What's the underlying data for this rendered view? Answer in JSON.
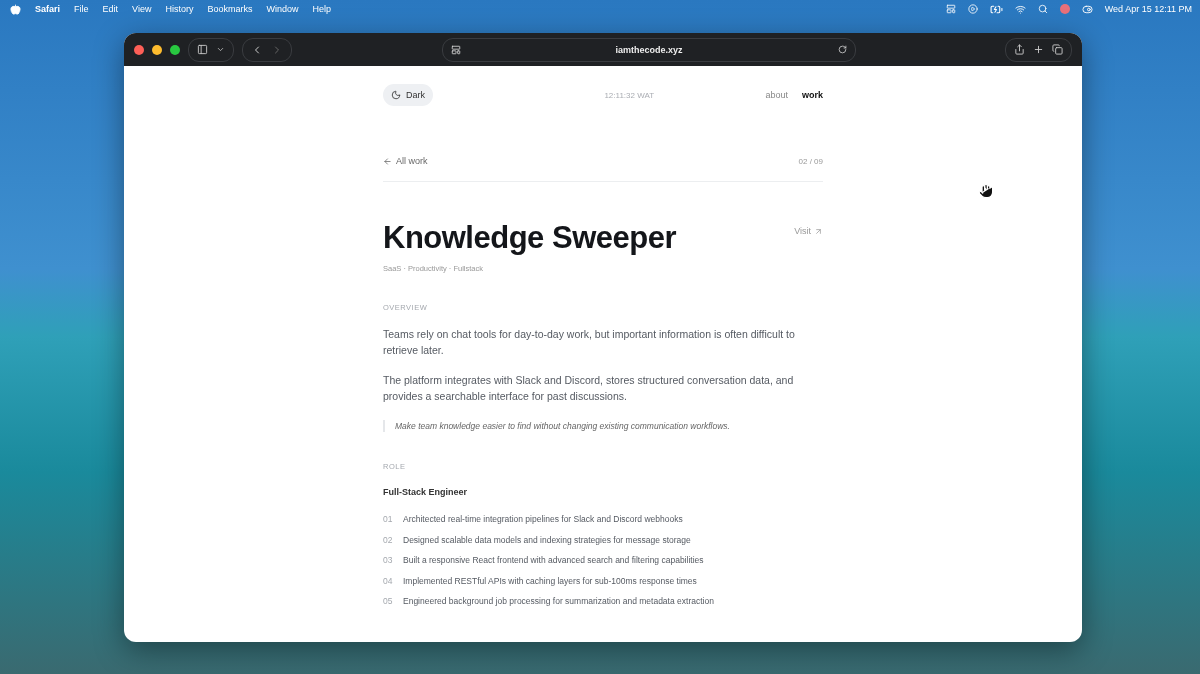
{
  "menu_bar": {
    "app": "Safari",
    "items": [
      "File",
      "Edit",
      "View",
      "History",
      "Bookmarks",
      "Window",
      "Help"
    ],
    "clock": "Wed Apr 15  12:11 PM"
  },
  "browser": {
    "url": "iamthecode.xyz"
  },
  "page": {
    "theme_toggle": "Dark",
    "time": "12:11:32 WAT",
    "nav": [
      {
        "label": "about",
        "selected": false
      },
      {
        "label": "work",
        "selected": true
      }
    ],
    "back_link": "All work",
    "counter": "02 / 09",
    "title": "Knowledge Sweeper",
    "visit": "Visit",
    "tags": "SaaS · Productivity · Fullstack",
    "overview_heading": "OVERVIEW",
    "paragraphs": [
      "Teams rely on chat tools for day-to-day work, but important information is often difficult to retrieve later.",
      "The platform integrates with Slack and Discord, stores structured conversation data, and provides a searchable interface for past discussions."
    ],
    "quote": "Make team knowledge easier to find without changing existing communication workflows.",
    "role_heading": "ROLE",
    "role": "Full-Stack Engineer",
    "items": [
      {
        "number": "01",
        "text": "Architected real-time integration pipelines for Slack and Discord webhooks"
      },
      {
        "number": "02",
        "text": "Designed scalable data models and indexing strategies for message storage"
      },
      {
        "number": "03",
        "text": "Built a responsive React frontend with advanced search and filtering capabilities"
      },
      {
        "number": "04",
        "text": "Implemented RESTful APIs with caching layers for sub-100ms response times"
      },
      {
        "number": "05",
        "text": "Engineered background job processing for summarization and metadata extraction"
      }
    ]
  }
}
